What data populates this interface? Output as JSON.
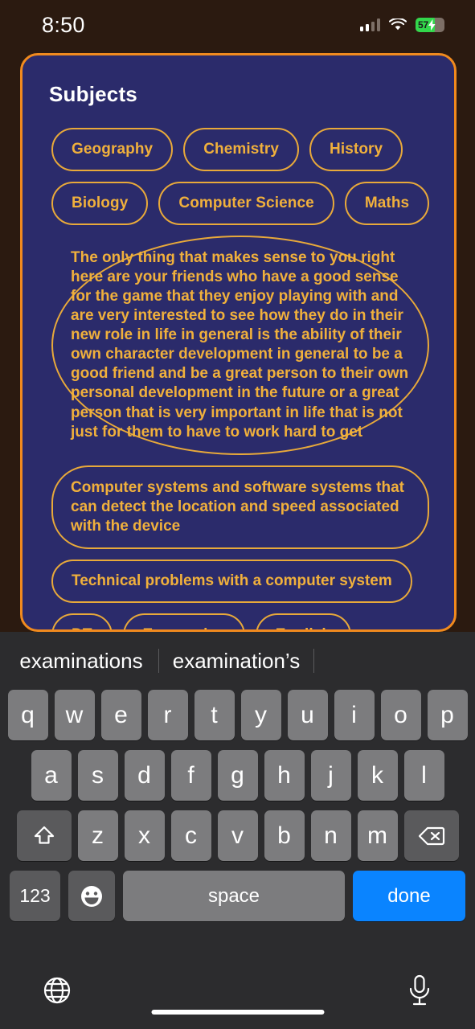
{
  "status_bar": {
    "time": "8:50",
    "battery_percent": "57",
    "battery_color": "#32d74b",
    "icons": [
      "cellular-signal-icon",
      "wifi-icon",
      "battery-charging-icon"
    ]
  },
  "card": {
    "title": "Subjects",
    "background_color": "#2b2b6b",
    "border_color": "#f08a1e",
    "chip_color": "#f0b03c",
    "rows": [
      [
        "Geography",
        "Chemistry",
        "History"
      ],
      [
        "Biology",
        "Computer Science",
        "Maths"
      ]
    ],
    "long_chips": [
      "The only thing that makes sense to you right here are your friends who have a good sense for the game that they enjoy playing with and are very interested to see how they do in their new role in life in general is the ability of their own character development in general to be a good friend and be a great person to their own personal development in the future or a great person that is very important in life that is not just for them to have to work hard to get",
      "Computer systems and software systems that can detect the location and speed associated with the device",
      "Technical problems with a computer system"
    ],
    "bottom_row": [
      "DT",
      "Economics",
      "English"
    ]
  },
  "keyboard": {
    "suggestions": [
      "examinations",
      "examination’s"
    ],
    "row1": [
      "q",
      "w",
      "e",
      "r",
      "t",
      "y",
      "u",
      "i",
      "o",
      "p"
    ],
    "row2": [
      "a",
      "s",
      "d",
      "f",
      "g",
      "h",
      "j",
      "k",
      "l"
    ],
    "row3": [
      "z",
      "x",
      "c",
      "v",
      "b",
      "n",
      "m"
    ],
    "shift_label": "shift-icon",
    "backspace_label": "backspace-icon",
    "numeric_label": "123",
    "emoji_label": "emoji-icon",
    "space_label": "space",
    "done_label": "done",
    "done_color": "#0a84ff",
    "globe_label": "globe-icon",
    "mic_label": "microphone-icon"
  }
}
